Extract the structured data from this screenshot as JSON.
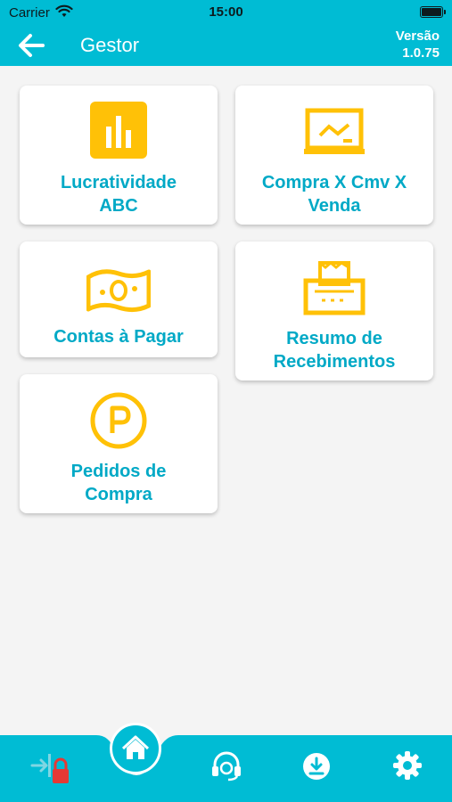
{
  "status_bar": {
    "carrier": "Carrier",
    "time": "15:00"
  },
  "header": {
    "title": "Gestor",
    "version_label": "Versão",
    "version_number": "1.0.75"
  },
  "menu": {
    "items": [
      {
        "label_line1": "Lucratividade",
        "label_line2": "ABC",
        "icon": "bar-chart-icon"
      },
      {
        "label_line1": "Compra X Cmv X",
        "label_line2": "Venda",
        "icon": "line-chart-monitor-icon"
      },
      {
        "label_line1": "Contas à Pagar",
        "label_line2": "",
        "icon": "banknote-icon"
      },
      {
        "label_line1": "Resumo de",
        "label_line2": "Recebimentos",
        "icon": "receipt-printer-icon"
      },
      {
        "label_line1": "Pedidos de",
        "label_line2": "Compra",
        "icon": "parking-circle-icon"
      }
    ]
  },
  "bottom_nav": {
    "items": [
      "logout-lock-icon",
      "home-icon",
      "support-headset-icon",
      "download-icon",
      "settings-gear-icon"
    ],
    "active": "home-icon"
  },
  "colors": {
    "primary": "#00bcd4",
    "accent_text": "#00a9c6",
    "icon_yellow": "#ffc107",
    "lock_red": "#e53935",
    "background": "#f4f4f4"
  }
}
